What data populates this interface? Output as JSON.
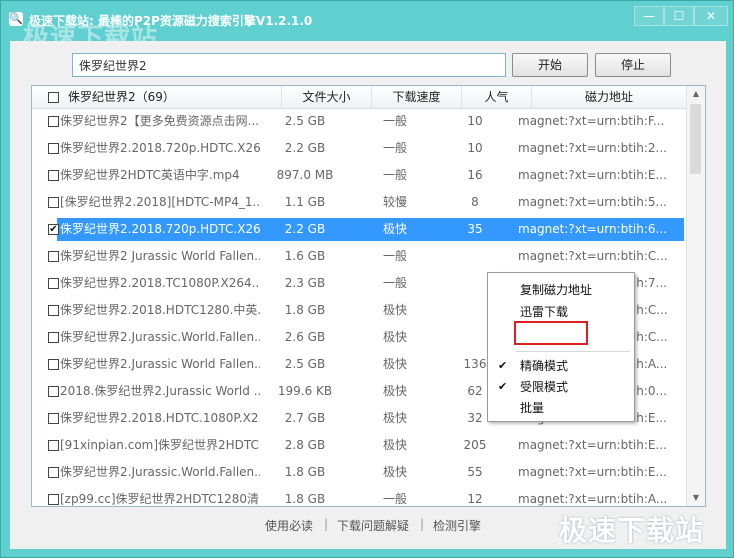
{
  "window": {
    "title": "极速下载站: 最棒的P2P资源磁力搜索引擎V1.2.1.0",
    "watermark_top": "极速下载站",
    "watermark_bottom": "极速下载站",
    "controls": {
      "minimize": "—",
      "maximize": "☐",
      "close": "✕"
    }
  },
  "search": {
    "value": "侏罗纪世界2",
    "start_label": "开始",
    "stop_label": "停止"
  },
  "table": {
    "header": {
      "name": "侏罗纪世界2（69）",
      "size": "文件大小",
      "speed": "下载速度",
      "popularity": "人气",
      "magnet": "磁力地址"
    },
    "rows": [
      {
        "name": "侏罗纪世界2【更多免费资源点击网...",
        "size": "2.5 GB",
        "speed": "一般",
        "pop": "10",
        "magnet": "magnet:?xt=urn:btih:F...",
        "checked": false
      },
      {
        "name": "侏罗纪世界2.2018.720p.HDTC.X26...",
        "size": "2.2 GB",
        "speed": "一般",
        "pop": "10",
        "magnet": "magnet:?xt=urn:btih:2...",
        "checked": false
      },
      {
        "name": "侏罗纪世界2HDTC英语中字.mp4",
        "size": "897.0 MB",
        "speed": "一般",
        "pop": "16",
        "magnet": "magnet:?xt=urn:btih:E...",
        "checked": false
      },
      {
        "name": "[侏罗纪世界2.2018][HDTC-MP4_1....",
        "size": "1.1 GB",
        "speed": "较慢",
        "pop": "8",
        "magnet": "magnet:?xt=urn:btih:5...",
        "checked": false
      },
      {
        "name": "侏罗纪世界2.2018.720p.HDTC.X26...",
        "size": "2.2 GB",
        "speed": "极快",
        "pop": "35",
        "magnet": "magnet:?xt=urn:btih:6...",
        "checked": true,
        "selected": true
      },
      {
        "name": "侏罗纪世界2 Jurassic World Fallen...",
        "size": "1.6 GB",
        "speed": "一般",
        "pop": "",
        "magnet": "magnet:?xt=urn:btih:C...",
        "checked": false
      },
      {
        "name": "侏罗纪世界2.2018.TC1080P.X264....",
        "size": "2.3 GB",
        "speed": "一般",
        "pop": "",
        "magnet": "magnet:?xt=urn:btih:7...",
        "checked": false
      },
      {
        "name": "侏罗纪世界2.2018.HDTC1280.中英...",
        "size": "1.8 GB",
        "speed": "极快",
        "pop": "",
        "magnet": "magnet:?xt=urn:btih:C...",
        "checked": false
      },
      {
        "name": "侏罗纪世界2.Jurassic.World.Fallen...",
        "size": "2.6 GB",
        "speed": "极快",
        "pop": "",
        "magnet": "magnet:?xt=urn:btih:C...",
        "checked": false
      },
      {
        "name": "侏罗纪世界2.Jurassic World Fallen...",
        "size": "2.5 GB",
        "speed": "极快",
        "pop": "136",
        "magnet": "magnet:?xt=urn:btih:A...",
        "checked": false
      },
      {
        "name": "2018.侏罗纪世界2.Jurassic World ...",
        "size": "199.6 KB",
        "speed": "极快",
        "pop": "62",
        "magnet": "magnet:?xt=urn:btih:0...",
        "checked": false
      },
      {
        "name": "侏罗纪世界2.2018.HDTC.1080P.X2...",
        "size": "2.7 GB",
        "speed": "极快",
        "pop": "32",
        "magnet": "magnet:?xt=urn:btih:E...",
        "checked": false
      },
      {
        "name": "[91xinpian.com]侏罗纪世界2HDTC...",
        "size": "2.8 GB",
        "speed": "极快",
        "pop": "205",
        "magnet": "magnet:?xt=urn:btih:E...",
        "checked": false
      },
      {
        "name": "侏罗纪世界2.Jurassic.World.Fallen...",
        "size": "1.8 GB",
        "speed": "极快",
        "pop": "55",
        "magnet": "magnet:?xt=urn:btih:E...",
        "checked": false
      },
      {
        "name": "[zp99.cc]侏罗纪世界2HDTC1280清...",
        "size": "1.8 GB",
        "speed": "一般",
        "pop": "12",
        "magnet": "magnet:?xt=urn:btih:A...",
        "checked": false
      }
    ]
  },
  "context_menu": {
    "items": [
      {
        "label": "复制磁力地址",
        "checked": false
      },
      {
        "label": "迅雷下载",
        "checked": false,
        "highlighted": true
      },
      {
        "label": "精确模式",
        "checked": true
      },
      {
        "label": "受限模式",
        "checked": true
      },
      {
        "label": "批量",
        "checked": false
      }
    ],
    "check_glyph": "✔"
  },
  "footer": {
    "links": [
      "使用必读",
      "下载问题解疑",
      "检测引擎"
    ],
    "separator": "|"
  },
  "scrollbar": {
    "up": "▲",
    "down": "▼"
  }
}
